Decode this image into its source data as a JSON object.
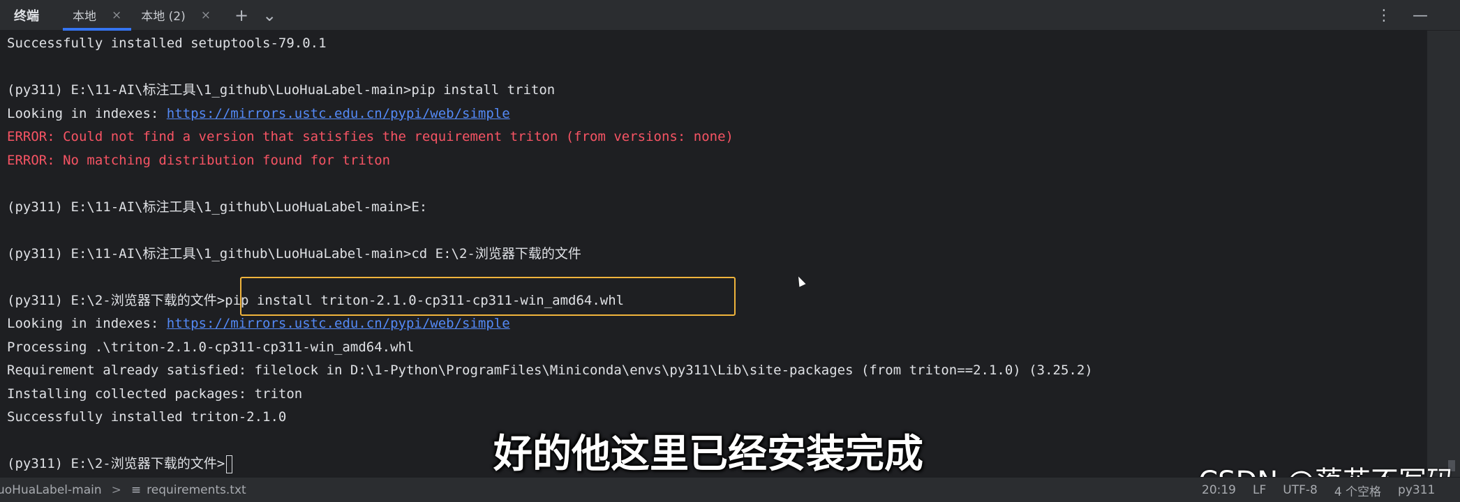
{
  "tabbar": {
    "title": "终端",
    "tabs": [
      {
        "label": "本地",
        "close": "×"
      },
      {
        "label": "本地 (2)",
        "close": "×"
      }
    ],
    "add_icon": "+",
    "dropdown_icon": "⌄",
    "menu_icon": "⋮",
    "minimize_icon": "—"
  },
  "terminal": {
    "lines": [
      {
        "text": "Successfully installed setuptools-79.0.1"
      },
      {
        "text": ""
      },
      {
        "text": "(py311) E:\\11-AI\\标注工具\\1_github\\LuoHuaLabel-main>pip install triton"
      },
      {
        "prefix": "Looking in indexes: ",
        "link": "https://mirrors.ustc.edu.cn/pypi/web/simple"
      },
      {
        "text": "ERROR: Could not find a version that satisfies the requirement triton (from versions: none)",
        "error": true
      },
      {
        "text": "ERROR: No matching distribution found for triton",
        "error": true
      },
      {
        "text": ""
      },
      {
        "text": "(py311) E:\\11-AI\\标注工具\\1_github\\LuoHuaLabel-main>E:"
      },
      {
        "text": ""
      },
      {
        "text": "(py311) E:\\11-AI\\标注工具\\1_github\\LuoHuaLabel-main>cd E:\\2-浏览器下载的文件"
      },
      {
        "text": ""
      },
      {
        "text": "(py311) E:\\2-浏览器下载的文件>pip install triton-2.1.0-cp311-cp311-win_amd64.whl"
      },
      {
        "prefix": "Looking in indexes: ",
        "link": "https://mirrors.ustc.edu.cn/pypi/web/simple"
      },
      {
        "text": "Processing .\\triton-2.1.0-cp311-cp311-win_amd64.whl"
      },
      {
        "text": "Requirement already satisfied: filelock in D:\\1-Python\\ProgramFiles\\Miniconda\\envs\\py311\\Lib\\site-packages (from triton==2.1.0) (3.25.2)"
      },
      {
        "text": "Installing collected packages: triton"
      },
      {
        "text": "Successfully installed triton-2.1.0"
      },
      {
        "text": ""
      },
      {
        "text": "(py311) E:\\2-浏览器下载的文件>",
        "caret": true
      }
    ]
  },
  "subtitle": "好的他这里已经安装完成",
  "watermark": "CSDN @落花不写码",
  "statusbar": {
    "breadcrumb": "uoHuaLabel-main",
    "separator": ">",
    "file_icon": "≡",
    "file": "requirements.txt",
    "position": "20:19",
    "line_ending": "LF",
    "encoding": "UTF-8",
    "indent": "4 个空格",
    "interpreter": "py311"
  },
  "colors": {
    "accent": "#3574f0",
    "error": "#f75464",
    "link": "#548af7",
    "highlight_box": "#f0b43c"
  }
}
